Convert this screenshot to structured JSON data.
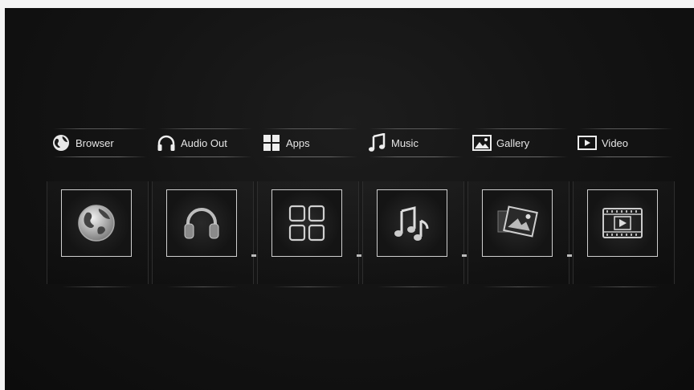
{
  "menu": {
    "items": [
      {
        "label": "Browser",
        "icon": "globe-icon"
      },
      {
        "label": "Audio Out",
        "icon": "headphones-icon"
      },
      {
        "label": "Apps",
        "icon": "apps-grid-icon"
      },
      {
        "label": "Music",
        "icon": "music-note-icon"
      },
      {
        "label": "Gallery",
        "icon": "image-icon"
      },
      {
        "label": "Video",
        "icon": "video-icon"
      }
    ]
  },
  "colors": {
    "background": "#121212",
    "text": "#e6e6e6",
    "frame": "#cfcfcf"
  }
}
